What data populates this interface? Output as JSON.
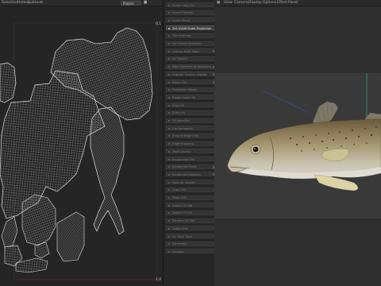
{
  "uv_editor": {
    "menu": [
      "Selection",
      "Hotkey",
      "Subtools"
    ],
    "project_select": "Project",
    "tool_icons": [
      "▲",
      "▤",
      "▦",
      "☷"
    ],
    "corner_label_top": "0,1",
    "corner_label_bottom": "1,0"
  },
  "toolkit": {
    "items": [
      "Smart Loop Cut",
      "Smart Extrude",
      "Smart Bevel",
      "Set UV/dt Scale Projection",
      "Tile Chaining",
      "Set Seams Selection",
      "Unwrap Both Sides",
      "UV Repack",
      "Mark Selected as Boundary",
      "Checker Overlay Display",
      "Relax UVs",
      "Straighten Edges",
      "Rotate Island 90",
      "Align UV",
      "Stitch UV",
      "Fill Selection",
      "Flip Horizontal",
      "Snap to Edge Cuts",
      "Edge Snapping",
      "Texel Density",
      "Randomize UVs",
      "Randomize Scale",
      "Randomize Rotation",
      "Pack UV Islands",
      "Copy UVs",
      "Paste UVs",
      "Create UV Set",
      "Delete UV Set",
      "Rename UV Set",
      "Unfold UVs",
      "UV Shell Tools",
      "Symmetry",
      "Average"
    ],
    "selected_index": 3
  },
  "viewport": {
    "menu": [
      "View",
      "Camera",
      "Display",
      "Options",
      "Effect",
      "Panel"
    ],
    "icons": [
      "■",
      "▶"
    ]
  },
  "colors": {
    "uv_wire": "#c9c9c9",
    "uv_bg": "#252525",
    "viewport_bg": "#393939",
    "gizmo_axis": "#2f9c5a",
    "gizmo_blue": "#3a4fb0"
  }
}
